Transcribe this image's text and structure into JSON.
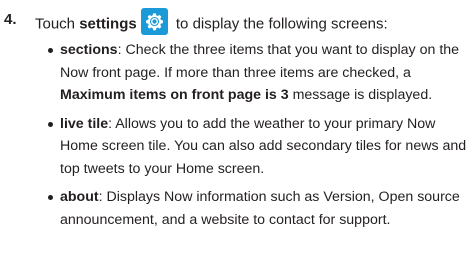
{
  "step": {
    "number": "4.",
    "text_before": "Touch ",
    "settings_word": "settings",
    "icon": "settings-gear-icon",
    "text_after": " to display the following screens:"
  },
  "bullets": [
    {
      "term": "sections",
      "text_before": ": Check the three items that you want to display on the Now front page. If more than three items are checked, a ",
      "bold_message": "Maximum items on front page is 3",
      "text_after": " message is displayed."
    },
    {
      "term": "live tile",
      "text": ": Allows you to add the weather to your primary Now Home screen tile. You can also add secondary tiles for news and top tweets to your Home screen."
    },
    {
      "term": "about",
      "text": ": Displays Now information such as Version, Open source announcement, and a website to contact for support."
    }
  ],
  "colors": {
    "text": "#231f20",
    "icon_background": "#1a9ad6",
    "icon_foreground": "#ffffff"
  }
}
